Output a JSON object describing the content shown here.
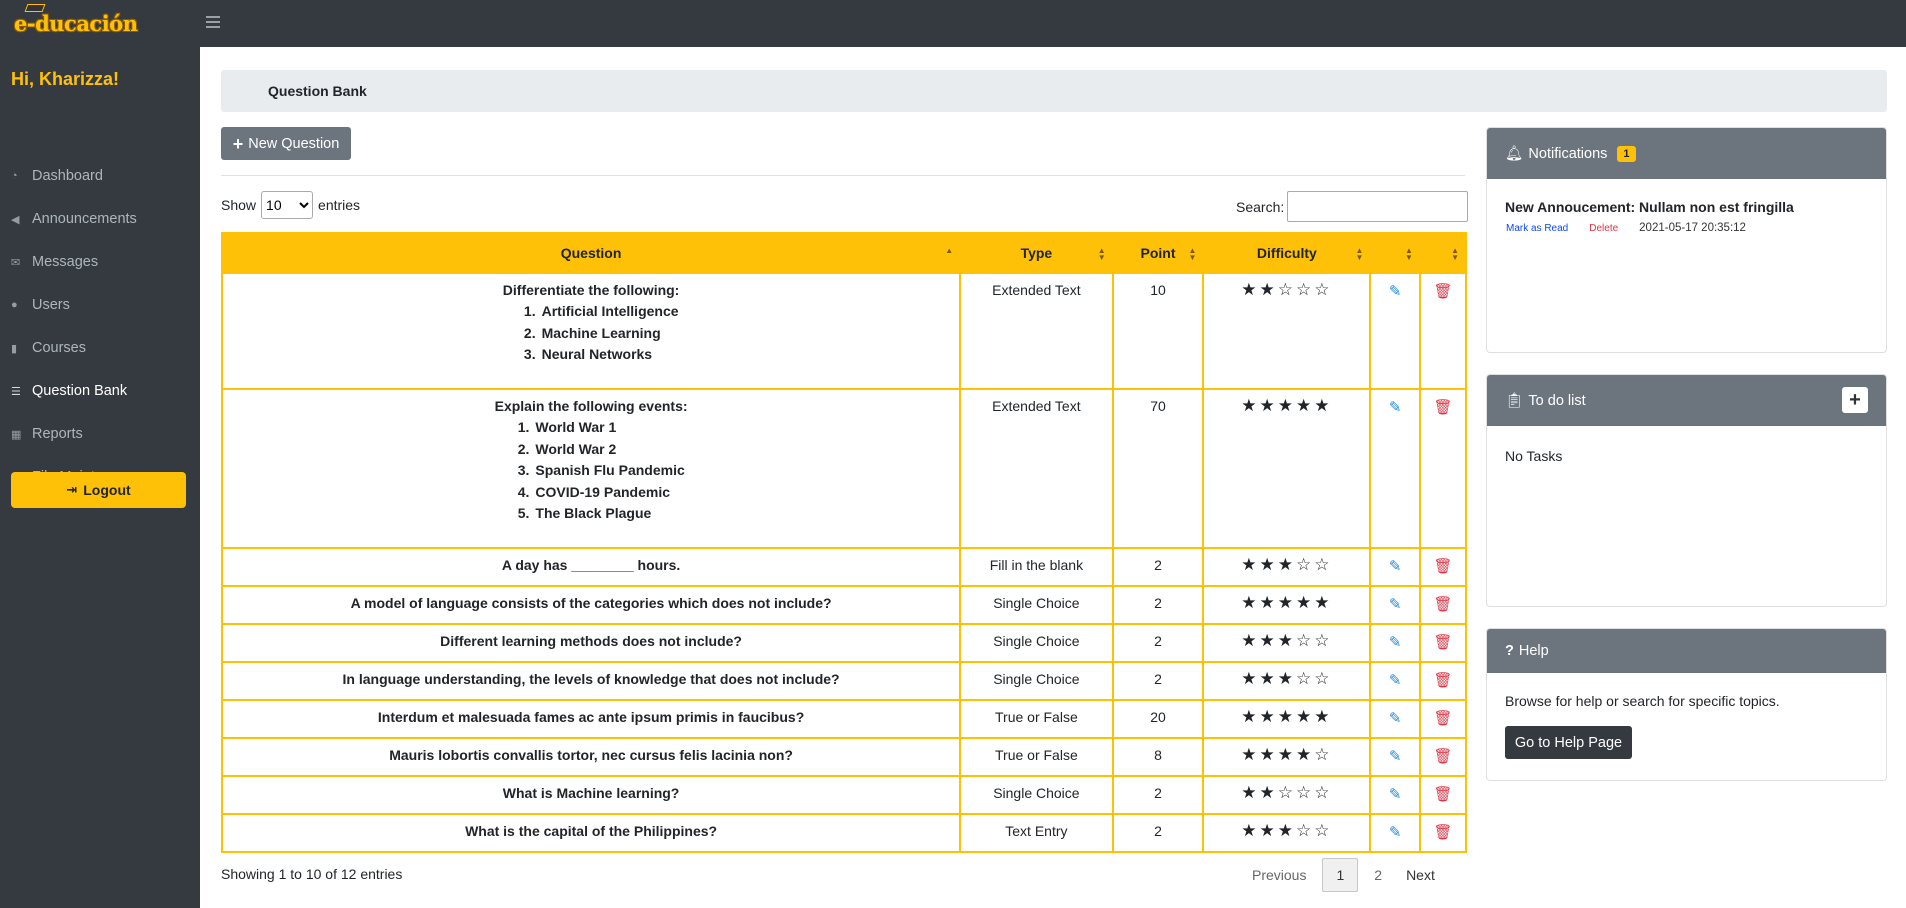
{
  "app": {
    "logo_text": "e-ducación"
  },
  "sidebar": {
    "greeting": "Hi, Kharizza!",
    "items": [
      {
        "label": "Dashboard",
        "icon": "dashboard-icon"
      },
      {
        "label": "Announcements",
        "icon": "bullhorn-icon"
      },
      {
        "label": "Messages",
        "icon": "envelope-icon"
      },
      {
        "label": "Users",
        "icon": "user-icon"
      },
      {
        "label": "Courses",
        "icon": "book-icon"
      },
      {
        "label": "Question Bank",
        "icon": "list-icon",
        "active": true
      },
      {
        "label": "Reports",
        "icon": "table-icon"
      },
      {
        "label": "File Maintenance",
        "icon": "wrench-icon"
      }
    ],
    "logout_label": "Logout"
  },
  "breadcrumb": {
    "title": "Question Bank"
  },
  "toolbar": {
    "new_question_label": "New Question"
  },
  "table_controls": {
    "show_label": "Show",
    "entries_label": "entries",
    "page_size": "10",
    "search_label": "Search:",
    "search_value": ""
  },
  "table": {
    "headers": [
      "Question",
      "Type",
      "Point",
      "Difficulty",
      "",
      ""
    ],
    "rows": [
      {
        "question": "Differentiate the following:",
        "list": [
          [
            "1.",
            "Artificial Intelligence"
          ],
          [
            "2.",
            "Machine Learning"
          ],
          [
            "3.",
            "Neural Networks"
          ]
        ],
        "type": "Extended Text",
        "point": "10",
        "difficulty": 2
      },
      {
        "question": "Explain the following events:",
        "list": [
          [
            "1.",
            "World War 1"
          ],
          [
            "2.",
            "World War 2"
          ],
          [
            "3.",
            "Spanish Flu Pandemic"
          ],
          [
            "4.",
            "COVID-19 Pandemic"
          ],
          [
            "5.",
            "The Black Plague"
          ]
        ],
        "type": "Extended Text",
        "point": "70",
        "difficulty": 5
      },
      {
        "question": "A day has ________ hours.",
        "list": [],
        "type": "Fill in the blank",
        "point": "2",
        "difficulty": 3
      },
      {
        "question": "A model of language consists of the categories which does not include?",
        "list": [],
        "type": "Single Choice",
        "point": "2",
        "difficulty": 5
      },
      {
        "question": "Different learning methods does not include?",
        "list": [],
        "type": "Single Choice",
        "point": "2",
        "difficulty": 3
      },
      {
        "question": "In language understanding, the levels of knowledge that does not include?",
        "list": [],
        "type": "Single Choice",
        "point": "2",
        "difficulty": 3
      },
      {
        "question": "Interdum et malesuada fames ac ante ipsum primis in faucibus?",
        "list": [],
        "type": "True or False",
        "point": "20",
        "difficulty": 5
      },
      {
        "question": "Mauris lobortis convallis tortor, nec cursus felis lacinia non?",
        "list": [],
        "type": "True or False",
        "point": "8",
        "difficulty": 4
      },
      {
        "question": "What is Machine learning?",
        "list": [],
        "type": "Single Choice",
        "point": "2",
        "difficulty": 2
      },
      {
        "question": "What is the capital of the Philippines?",
        "list": [],
        "type": "Text Entry",
        "point": "2",
        "difficulty": 3
      }
    ]
  },
  "footer": {
    "info": "Showing 1 to 10 of 12 entries",
    "previous": "Previous",
    "pages": [
      "1",
      "2"
    ],
    "current_page": "1",
    "next": "Next"
  },
  "notifications": {
    "title": "Notifications",
    "count": "1",
    "items": [
      {
        "title": "New Annoucement: Nullam non est fringilla",
        "mark_label": "Mark as Read",
        "delete_label": "Delete",
        "timestamp": "2021-05-17 20:35:12"
      }
    ]
  },
  "todo": {
    "title": "To do list",
    "empty_text": "No Tasks"
  },
  "help": {
    "title": "Help",
    "text": "Browse for help or search for specific topics.",
    "button_label": "Go to Help Page"
  },
  "colors": {
    "accent": "#ffc107",
    "dark": "#343a40",
    "gray": "#6c757d",
    "edit": "#1e88e5",
    "delete": "#dc3545"
  }
}
